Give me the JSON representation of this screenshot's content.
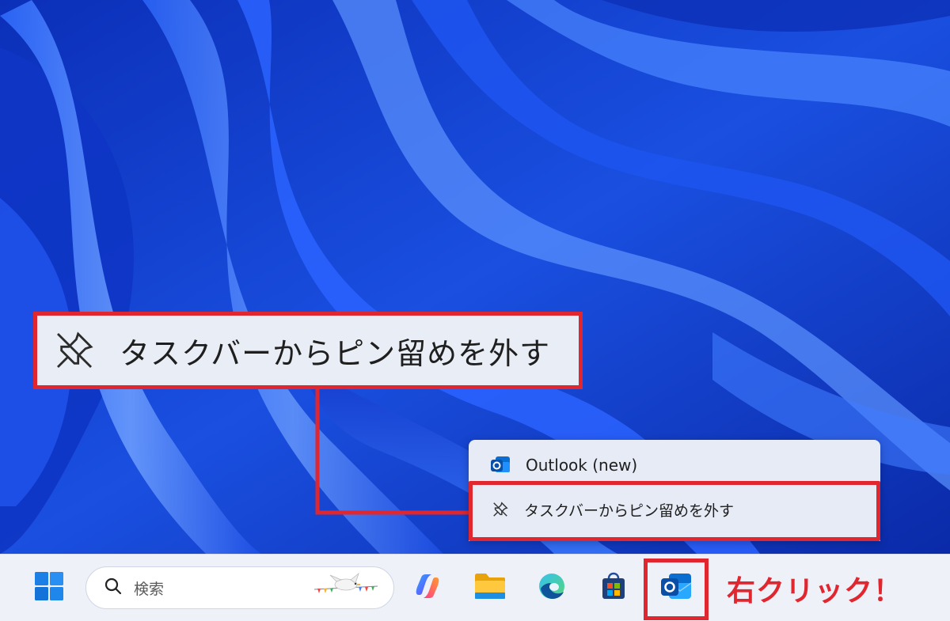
{
  "callout": {
    "zoom_label": "タスクバーからピン留めを外す",
    "icon": "unpin-icon"
  },
  "jumplist": {
    "app_name": "Outlook (new)",
    "app_icon": "outlook-icon",
    "unpin_label": "タスクバーからピン留めを外す",
    "unpin_icon": "unpin-icon"
  },
  "taskbar": {
    "search_placeholder": "検索",
    "icons": [
      "windows-start-icon",
      "search-icon",
      "copilot-icon",
      "file-explorer-icon",
      "edge-icon",
      "microsoft-store-icon",
      "outlook-icon"
    ]
  },
  "annotation": {
    "note": "右クリック！"
  },
  "colors": {
    "highlight_red": "#e0262e",
    "taskbar_bg": "#eef1f8",
    "menu_bg": "#e6ebf5",
    "wallpaper_blue": "#1746d6"
  }
}
